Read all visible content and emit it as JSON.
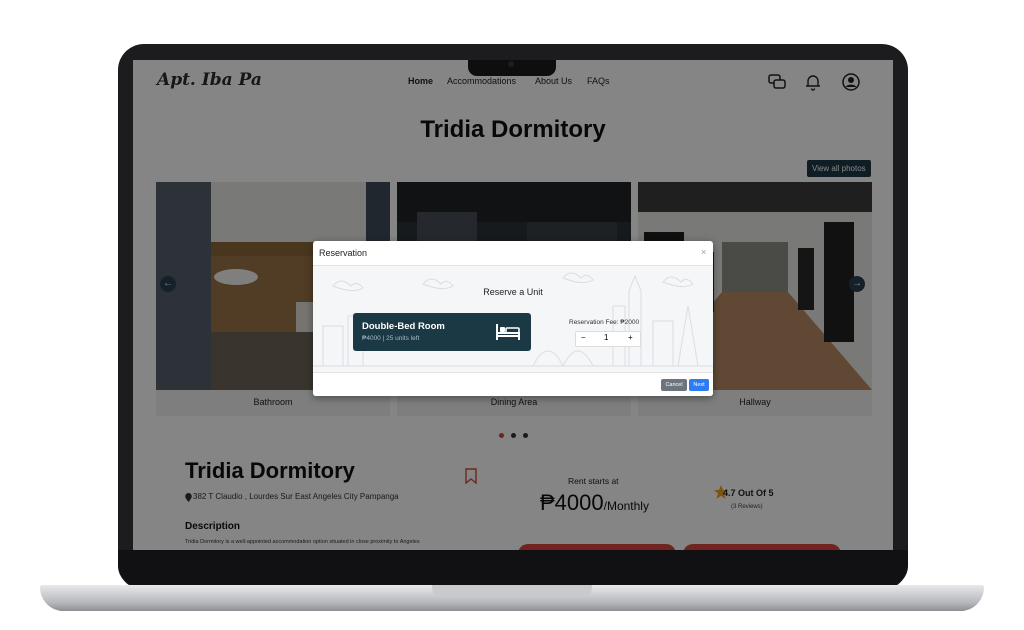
{
  "app": {
    "logo": "Apt. Iba Pa"
  },
  "nav": {
    "items": [
      {
        "label": "Home"
      },
      {
        "label": "Accommodations"
      },
      {
        "label": "About Us"
      },
      {
        "label": "FAQs"
      }
    ]
  },
  "icons": [
    "chat-icon",
    "bell-icon",
    "user-icon",
    "bed-icon",
    "bookmark-icon",
    "star-icon",
    "location-pin-icon"
  ],
  "page": {
    "title": "Tridia Dormitory",
    "view_all": "View all photos",
    "gallery": [
      {
        "caption": "Bathroom"
      },
      {
        "caption": "Dining Area"
      },
      {
        "caption": "Hallway"
      }
    ],
    "carousel_prev": "←",
    "carousel_next": "→"
  },
  "listing": {
    "name": "Tridia Dormitory",
    "address": "382 T Claudio , Lourdes Sur East Angeles City Pampanga",
    "description_heading": "Description",
    "description": "Tridia Dormitory is a well-appointed accommodation option situated in close proximity to Angeles",
    "rent_label": "Rent starts at",
    "price": "₱4000",
    "price_period": "/Monthly",
    "rating": "4.7 Out Of 5",
    "reviews": "(3 Reviews)"
  },
  "modal": {
    "title": "Reservation",
    "close": "×",
    "subtitle": "Reserve a Unit",
    "unit_name": "Double-Bed Room",
    "unit_info": "₱4000 | 25 units left",
    "fee": "Reservation Fee: ₱2000",
    "minus": "−",
    "quantity": "1",
    "plus": "+",
    "cancel": "Cancel",
    "next": "Next"
  },
  "colors": {
    "primary": "#1b3845",
    "accent": "#d9463c",
    "next_button": "#2f7bf5",
    "star": "#f0a020"
  }
}
